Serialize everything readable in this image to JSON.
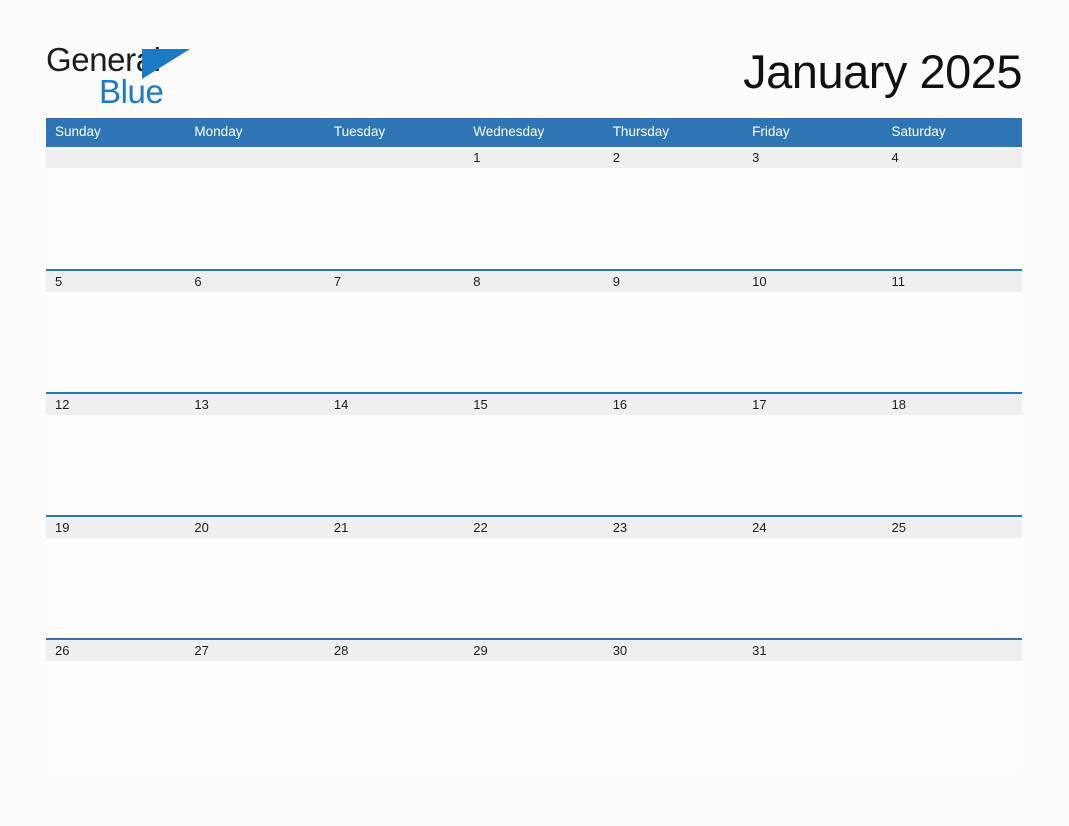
{
  "brand": {
    "word_one": "General",
    "word_two": "Blue",
    "triangle_icon": "blue-triangle-icon",
    "accent_color": "#1a7ac4",
    "text_color": "#1c1c1c"
  },
  "header": {
    "title": "January 2025",
    "month": "January",
    "year": "2025"
  },
  "calendar": {
    "header_background": "#2e75b6",
    "date_band_background": "#efefef",
    "cell_background": "#fdfdfd",
    "weekdays": [
      "Sunday",
      "Monday",
      "Tuesday",
      "Wednesday",
      "Thursday",
      "Friday",
      "Saturday"
    ],
    "weeks": [
      {
        "days": [
          {
            "date": "",
            "events": ""
          },
          {
            "date": "",
            "events": ""
          },
          {
            "date": "",
            "events": ""
          },
          {
            "date": "1",
            "events": ""
          },
          {
            "date": "2",
            "events": ""
          },
          {
            "date": "3",
            "events": ""
          },
          {
            "date": "4",
            "events": ""
          }
        ]
      },
      {
        "days": [
          {
            "date": "5",
            "events": ""
          },
          {
            "date": "6",
            "events": ""
          },
          {
            "date": "7",
            "events": ""
          },
          {
            "date": "8",
            "events": ""
          },
          {
            "date": "9",
            "events": ""
          },
          {
            "date": "10",
            "events": ""
          },
          {
            "date": "11",
            "events": ""
          }
        ]
      },
      {
        "days": [
          {
            "date": "12",
            "events": ""
          },
          {
            "date": "13",
            "events": ""
          },
          {
            "date": "14",
            "events": ""
          },
          {
            "date": "15",
            "events": ""
          },
          {
            "date": "16",
            "events": ""
          },
          {
            "date": "17",
            "events": ""
          },
          {
            "date": "18",
            "events": ""
          }
        ]
      },
      {
        "days": [
          {
            "date": "19",
            "events": ""
          },
          {
            "date": "20",
            "events": ""
          },
          {
            "date": "21",
            "events": ""
          },
          {
            "date": "22",
            "events": ""
          },
          {
            "date": "23",
            "events": ""
          },
          {
            "date": "24",
            "events": ""
          },
          {
            "date": "25",
            "events": ""
          }
        ]
      },
      {
        "days": [
          {
            "date": "26",
            "events": ""
          },
          {
            "date": "27",
            "events": ""
          },
          {
            "date": "28",
            "events": ""
          },
          {
            "date": "29",
            "events": ""
          },
          {
            "date": "30",
            "events": ""
          },
          {
            "date": "31",
            "events": ""
          },
          {
            "date": "",
            "events": ""
          }
        ]
      }
    ]
  }
}
